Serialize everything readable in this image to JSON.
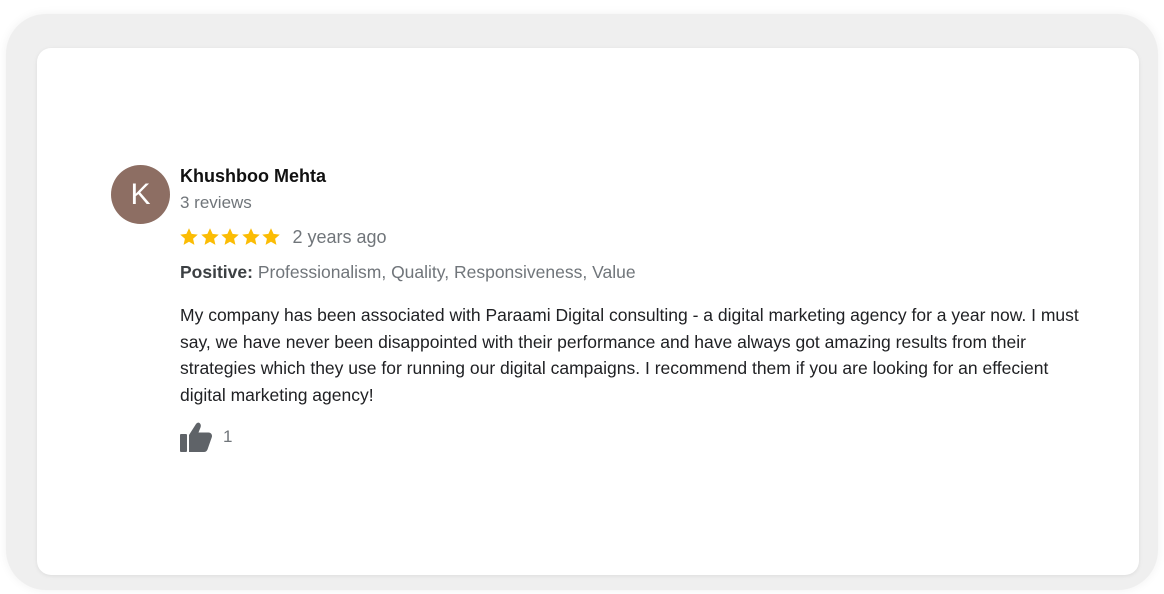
{
  "review": {
    "reviewer": {
      "initial": "K",
      "name": "Khushboo Mehta",
      "review_count": "3 reviews",
      "avatar_color": "#8d6e63"
    },
    "rating": {
      "stars": 5,
      "max_stars": 5,
      "star_color": "#fbbc04"
    },
    "date": "2 years ago",
    "attributes": {
      "label": "Positive:",
      "values": "Professionalism, Quality, Responsiveness, Value"
    },
    "text": "My company has been associated with Paraami Digital consulting - a digital marketing agency for a year now. I must say, we have never been disappointed with their performance and have always got amazing results from their strategies which they use for running our digital campaigns. I recommend them if you are looking for an effecient digital marketing agency!",
    "helpful": {
      "icon": "thumbs-up-icon",
      "count": "1",
      "icon_color": "#5f6368"
    }
  }
}
